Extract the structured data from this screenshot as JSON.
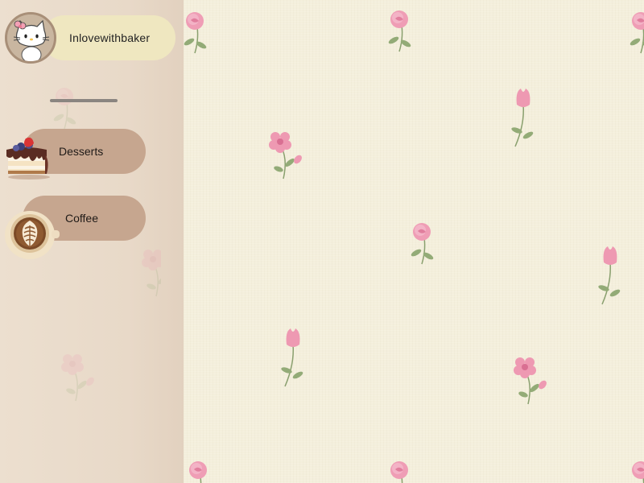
{
  "profile": {
    "username": "Inlovewithbaker",
    "avatar_icon": "kitty-avatar-icon"
  },
  "nav": {
    "items": [
      {
        "label": "Desserts",
        "icon": "cake-slice-icon"
      },
      {
        "label": "Coffee",
        "icon": "latte-art-icon"
      }
    ]
  },
  "theme": {
    "sidebar_bg": "#e8d9c8",
    "nav_pill": "#c6a68f",
    "profile_pill": "#efe7c0",
    "canvas_bg": "#f4efdc",
    "flower_pink": "#e98aa8",
    "leaf_green": "#8aa06f"
  }
}
